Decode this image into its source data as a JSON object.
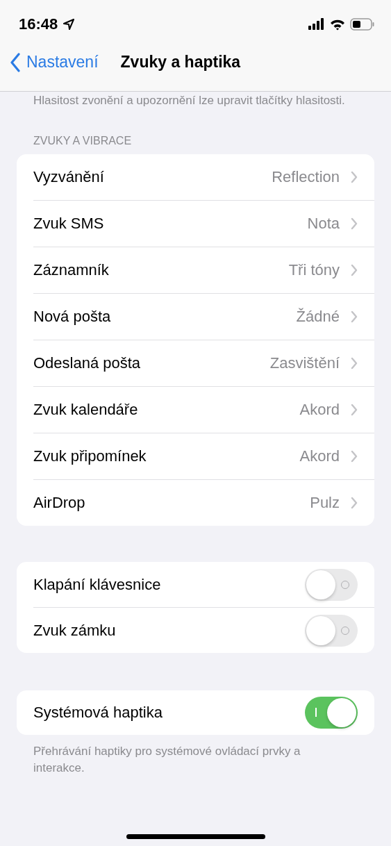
{
  "status_bar": {
    "time": "16:48"
  },
  "nav": {
    "back": "Nastavení",
    "title": "Zvuky a haptika"
  },
  "intro": "Hlasitost zvonění a upozornění lze upravit tlačítky hlasitosti.",
  "section_header": "ZVUKY A VIBRACE",
  "sounds": [
    {
      "label": "Vyzvánění",
      "value": "Reflection"
    },
    {
      "label": "Zvuk SMS",
      "value": "Nota"
    },
    {
      "label": "Záznamník",
      "value": "Tři tóny"
    },
    {
      "label": "Nová pošta",
      "value": "Žádné"
    },
    {
      "label": "Odeslaná pošta",
      "value": "Zasvištění"
    },
    {
      "label": "Zvuk kalendáře",
      "value": "Akord"
    },
    {
      "label": "Zvuk připomínek",
      "value": "Akord"
    },
    {
      "label": "AirDrop",
      "value": "Pulz"
    }
  ],
  "toggles": [
    {
      "label": "Klapání klávesnice",
      "on": false
    },
    {
      "label": "Zvuk zámku",
      "on": false
    }
  ],
  "haptics": {
    "label": "Systémová haptika",
    "on": true
  },
  "footer": "Přehrávání haptiky pro systémové ovládací prvky a interakce."
}
